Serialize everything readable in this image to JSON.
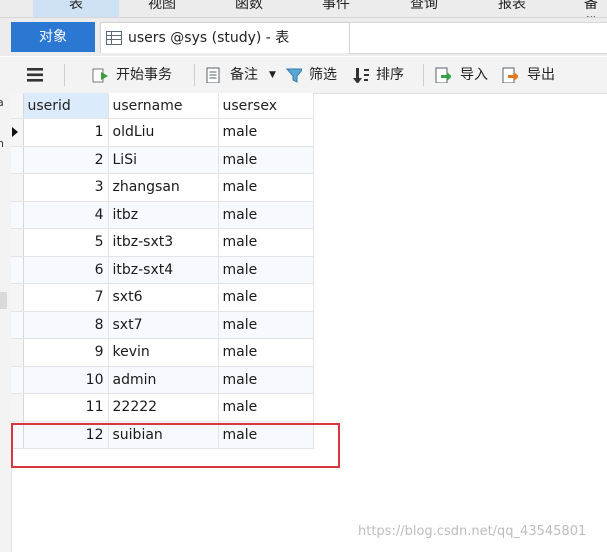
{
  "menubar": {
    "items": [
      "表",
      "视图",
      "函数",
      "事件",
      "查询",
      "报表",
      "备份"
    ]
  },
  "tabs": {
    "objects": "对象",
    "table_tab": "users @sys (study) - 表"
  },
  "toolbar": {
    "begin_transaction": "开始事务",
    "memo": "备注",
    "filter": "筛选",
    "sort": "排序",
    "import": "导入",
    "export": "导出"
  },
  "left_fragments": [
    "a",
    "n"
  ],
  "table": {
    "columns": [
      "userid",
      "username",
      "usersex"
    ],
    "rows": [
      {
        "userid": "1",
        "username": "oldLiu",
        "usersex": "male"
      },
      {
        "userid": "2",
        "username": "LiSi",
        "usersex": "male"
      },
      {
        "userid": "3",
        "username": "zhangsan",
        "usersex": "male"
      },
      {
        "userid": "4",
        "username": "itbz",
        "usersex": "male"
      },
      {
        "userid": "5",
        "username": "itbz-sxt3",
        "usersex": "male"
      },
      {
        "userid": "6",
        "username": "itbz-sxt4",
        "usersex": "male"
      },
      {
        "userid": "7",
        "username": "sxt6",
        "usersex": "male"
      },
      {
        "userid": "8",
        "username": "sxt7",
        "usersex": "male"
      },
      {
        "userid": "9",
        "username": "kevin",
        "usersex": "male"
      },
      {
        "userid": "10",
        "username": "admin",
        "usersex": "male"
      },
      {
        "userid": "11",
        "username": "22222",
        "usersex": "male"
      },
      {
        "userid": "12",
        "username": "suibian",
        "usersex": "male"
      }
    ]
  },
  "watermark": "https://blog.csdn.net/qq_43545801",
  "colors": {
    "accent": "#2b78d3",
    "highlight_border": "#d9363e",
    "selected_header": "#dcebfb"
  }
}
